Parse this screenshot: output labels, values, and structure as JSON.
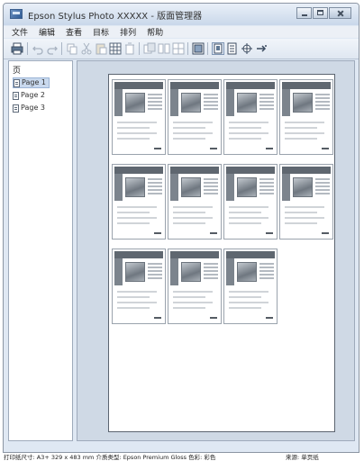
{
  "window": {
    "title": "Epson Stylus Photo XXXXX - 版面管理器"
  },
  "menu": [
    "文件",
    "编辑",
    "查看",
    "目标",
    "排列",
    "帮助"
  ],
  "toolbar": {
    "buttons": [
      "printer-icon",
      "undo-icon",
      "redo-icon",
      "copy-icon",
      "cut-icon",
      "paste-icon",
      "grid-icon",
      "delete-icon",
      "layer-icon",
      "align-icon",
      "distribute-icon",
      "fit-page-icon",
      "zoom-page-icon",
      "zoom-width-icon",
      "zoom-in-icon",
      "rotate-icon"
    ]
  },
  "pages_panel": {
    "title": "页",
    "pages": [
      "Page 1",
      "Page 2",
      "Page 3"
    ],
    "selected_index": 0
  },
  "layout": {
    "columns": 4,
    "thumbnail_count": 11
  },
  "status": {
    "left": "打印纸尺寸: A3+ 329 x 483 mm 介质类型: Epson Premium Gloss 色彩: 彩色",
    "right": "来源: 单页纸"
  }
}
